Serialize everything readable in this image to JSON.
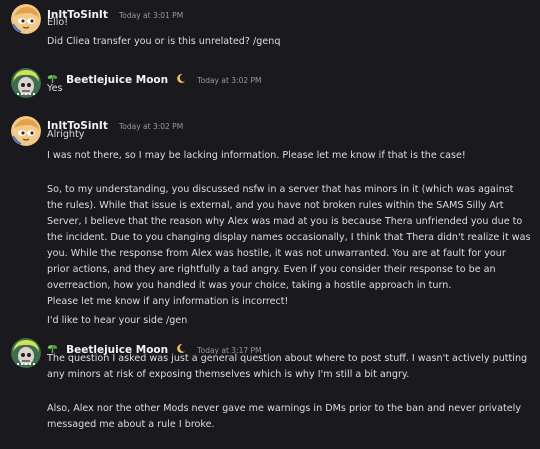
{
  "messages": [
    {
      "author": "InItToSinIt",
      "timestamp": "Today at 3:01 PM",
      "lines": [
        "Ello!",
        "Did Cliea transfer you or is this unrelated? /genq"
      ]
    },
    {
      "author": "Beetlejuice Moon",
      "timestamp": "Today at 3:02 PM",
      "lines": [
        "Yes"
      ]
    },
    {
      "author": "InItToSinIt",
      "timestamp": "Today at 3:02 PM",
      "lines": [
        "Alrighty",
        "I was not there, so I may be lacking information. Please let me know if that is the case!",
        "So, to my understanding, you discussed nsfw in a server that has minors in it (which was against",
        "the rules). While that issue is external, and you have not broken rules within the SAMS Silly Art",
        "Server, I believe that the reason why Alex was mad at you is because Thera unfriended you due to",
        "the incident. Due to you changing display names occasionally, I think that Thera didn't realize it was",
        "you. While the response from Alex was hostile, it was not unwarranted. You are at fault for your",
        "prior actions, and they are rightfully a tad angry. Even if you consider their response to be an",
        "overreaction, how you handled it was your choice, taking a hostile approach in turn.",
        "Please let me know if any information is incorrect!",
        "I'd like to hear your side /gen"
      ]
    },
    {
      "author": "Beetlejuice Moon",
      "timestamp": "Today at 3:17 PM",
      "lines": [
        "The question I asked was just a general question about where to post stuff. I wasn't actively putting",
        "any minors at risk of exposing themselves which is why I'm still a bit angry.",
        "Also, Alex nor the other Mods never gave me warnings in DMs prior to the ban and never privately",
        "messaged me about a rule I broke."
      ]
    }
  ],
  "icons": {
    "avatar_1": "cartoon-character-avatar",
    "avatar_2": "beetlejuice-avatar",
    "role_badge": "green-sprout-icon",
    "name_suffix": "crescent-moon-icon"
  },
  "colors": {
    "background": "#1a1a1e",
    "name": "#f2f3f5",
    "text": "#dbdee1",
    "timestamp": "#949ba4",
    "moon": "#f4c542",
    "badge": "#5fb84a"
  }
}
